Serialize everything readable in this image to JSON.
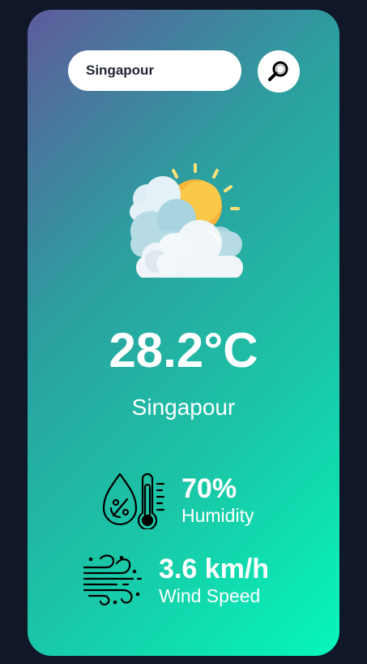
{
  "search": {
    "value": "Singapour",
    "icon": "magnifier-icon"
  },
  "weather": {
    "icon": "sun-behind-clouds-icon",
    "temperature": "28.2°C",
    "city": "Singapour"
  },
  "details": {
    "humidity": {
      "icon": "humidity-thermometer-icon",
      "value": "70%",
      "label": "Humidity"
    },
    "wind": {
      "icon": "wind-icon",
      "value": "3.6 km/h",
      "label": "Wind Speed"
    }
  },
  "colors": {
    "background": "#0f1729",
    "gradient_start": "#5e5b9b",
    "gradient_end": "#05f7bb",
    "text": "#ffffff"
  }
}
